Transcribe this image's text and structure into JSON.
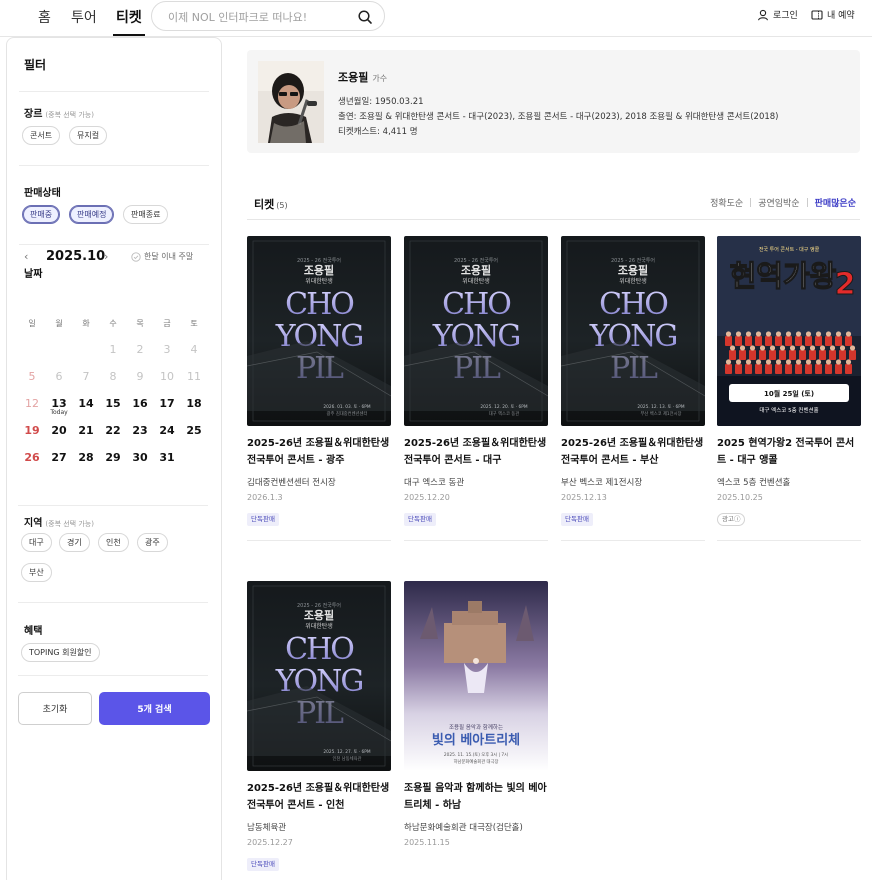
{
  "nav": {
    "tabs": [
      {
        "label": "홈"
      },
      {
        "label": "투어"
      },
      {
        "label": "티켓"
      }
    ],
    "search_placeholder": "이제 NOL 인터파크로 떠나요!",
    "login_label": "로그인",
    "my_booking_label": "내 예약"
  },
  "sidebar": {
    "title": "필터",
    "genre": {
      "title": "장르",
      "hint": "(중복 선택 가능)",
      "options": [
        "콘서트",
        "뮤지컬"
      ]
    },
    "sale_status": {
      "title": "판매상태",
      "options": [
        "판매중",
        "판매예정",
        "판매종료"
      ],
      "selected": [
        "판매중",
        "판매예정"
      ]
    },
    "date": {
      "title": "날짜",
      "month_label": "2025.10",
      "toggle_label": "한달 이내 주말",
      "weekdays": [
        "일",
        "월",
        "화",
        "수",
        "목",
        "금",
        "토"
      ],
      "rows": [
        [
          "",
          "",
          "",
          "1",
          "2",
          "3",
          "4"
        ],
        [
          "5",
          "6",
          "7",
          "8",
          "9",
          "10",
          "11"
        ],
        [
          "12",
          "13",
          "14",
          "15",
          "16",
          "17",
          "18"
        ],
        [
          "19",
          "20",
          "21",
          "22",
          "23",
          "24",
          "25"
        ],
        [
          "26",
          "27",
          "28",
          "29",
          "30",
          "31",
          ""
        ]
      ],
      "today": "13",
      "today_label": "Today"
    },
    "region": {
      "title": "지역",
      "hint": "(중복 선택 가능)",
      "options": [
        "대구",
        "경기",
        "인천",
        "광주",
        "부산"
      ]
    },
    "benefit": {
      "title": "혜택",
      "options": [
        "TOPING 회원할인"
      ]
    },
    "reset_label": "초기화",
    "search_button_label": "5개 검색"
  },
  "artist": {
    "name": "조용필",
    "role": "가수",
    "birth": "생년월일: 1950.03.21",
    "appearances": "출연: 조용필 & 위대한탄생 콘서트 - 대구(2023), 조용필 콘서트 - 대구(2023), 2018 조용필 & 위대한탄생 콘서트(2018)",
    "ticketcast": "티켓캐스트: 4,411 명"
  },
  "tickets": {
    "title": "티켓",
    "count": "(5)",
    "sort_options": [
      "정확도순",
      "공연임박순",
      "판매많은순"
    ],
    "active_sort": "판매많은순",
    "items": [
      {
        "title": "2025-26년 조용필＆위대한탄생 전국투어 콘서트 - 광주",
        "venue": "김대중컨벤션센터 전시장",
        "date": "2026.1.3",
        "badge": "단독판매",
        "poster_city": "광주 김대중컨벤션센터",
        "poster_date": "2026. 01. 03. 토 · 6PM"
      },
      {
        "title": "2025-26년 조용필＆위대한탄생 전국투어 콘서트 - 대구",
        "venue": "대구 엑스코 동관",
        "date": "2025.12.20",
        "badge": "단독판매",
        "poster_city": "대구 엑스코 동관",
        "poster_date": "2025. 12. 20. 토 · 6PM"
      },
      {
        "title": "2025-26년 조용필＆위대한탄생 전국투어 콘서트 - 부산",
        "venue": "부산 벡스코 제1전시장",
        "date": "2025.12.13",
        "badge": "단독판매",
        "poster_city": "부산 벡스코 제1전시장",
        "poster_date": "2025. 12. 13. 토 · 6PM"
      },
      {
        "title": "2025 현역가왕2 전국투어 콘서트 - 대구 앵콜",
        "venue": "엑스코 5층 컨벤션홀",
        "date": "2025.10.25",
        "badge": "광고ⓘ",
        "poster_top": "현역가왕",
        "poster_num": "2",
        "poster_sub": "전국 투어 콘서트 - 대구 앵콜",
        "poster_date": "10월 25일 (토)",
        "poster_venue": "대구 엑스코 5층 컨벤션홀"
      },
      {
        "title": "2025-26년 조용필＆위대한탄생 전국투어 콘서트 - 인천",
        "venue": "남동체육관",
        "date": "2025.12.27",
        "badge": "단독판매",
        "poster_city": "인천 남동체육관",
        "poster_date": "2025. 12. 27. 토 · 6PM"
      },
      {
        "title": "조용필 음악과 함께하는 빛의 베아트리체 - 하남",
        "venue": "하남문화예술회관 대극장(검단홀)",
        "date": "2025.11.15",
        "poster_sub": "조용필 음악과 함께하는",
        "poster_top": "빛의 베아트리체",
        "poster_date": "2025. 11. 15.(토) 오후 3시 | 7시",
        "poster_venue": "하남문화예술회관 대극장"
      }
    ]
  },
  "poster_common": {
    "tour_line": "2025 - 26 전국투어",
    "series_line": "조용필",
    "subtitle": "위대한탄생",
    "cho": "CHO",
    "yong": "YONG",
    "pil": "PIL"
  },
  "colors": {
    "accent": "#5b55e8",
    "selected_chip_border": "#6b6fb4",
    "badge_text": "#4d4dbb",
    "sunday": "#d14b4b"
  }
}
